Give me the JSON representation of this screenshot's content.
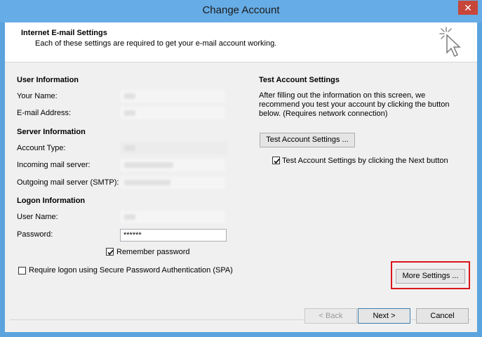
{
  "window": {
    "title": "Change Account",
    "close_glyph": "✕"
  },
  "header": {
    "title": "Internet E-mail Settings",
    "subtitle": "Each of these settings are required to get your e-mail account working.",
    "icon": "cursor-click-icon"
  },
  "user_info": {
    "section": "User Information",
    "name_label": "Your Name:",
    "email_label": "E-mail Address:"
  },
  "server_info": {
    "section": "Server Information",
    "account_type_label": "Account Type:",
    "incoming_label": "Incoming mail server:",
    "outgoing_label": "Outgoing mail server (SMTP):"
  },
  "logon_info": {
    "section": "Logon Information",
    "username_label": "User Name:",
    "password_label": "Password:",
    "password_value": "******",
    "remember_label": "Remember password",
    "remember_checked": true,
    "spa_label": "Require logon using Secure Password Authentication (SPA)",
    "spa_checked": false
  },
  "test": {
    "section": "Test Account Settings",
    "description": "After filling out the information on this screen, we recommend you test your account by clicking the button below. (Requires network connection)",
    "button": "Test Account Settings ...",
    "next_checkbox_label": "Test Account Settings by clicking the Next button",
    "next_checked": true
  },
  "more_settings_button": "More Settings ...",
  "footer": {
    "back": "< Back",
    "next": "Next >",
    "cancel": "Cancel"
  },
  "colors": {
    "title_bar": "#66ace6",
    "close": "#c7463a",
    "highlight": "#d9161c"
  }
}
